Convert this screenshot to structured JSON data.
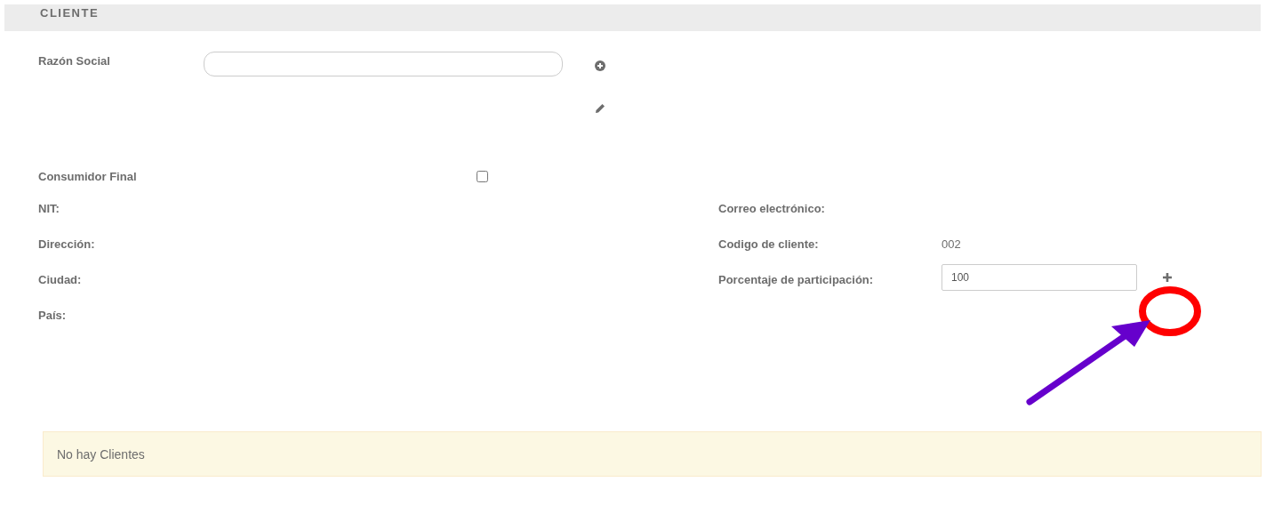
{
  "section": {
    "title": "CLIENTE"
  },
  "razon_social": {
    "label": "Razón Social"
  },
  "consumidor_final": {
    "label": "Consumidor Final",
    "checked": false
  },
  "left_fields": [
    {
      "label": "NIT:"
    },
    {
      "label": "Dirección:"
    },
    {
      "label": "Ciudad:"
    },
    {
      "label": "País:"
    }
  ],
  "right_fields": [
    {
      "label": "Correo electrónico:",
      "kind": "text"
    },
    {
      "label": "Codigo de cliente:",
      "kind": "text",
      "value": "002"
    },
    {
      "label": "Porcentaje de participación:",
      "kind": "input",
      "value": "100"
    }
  ],
  "alert": {
    "text": "No hay Clientes"
  },
  "annotations": [
    {
      "kind": "circle",
      "color": "#ff0000"
    },
    {
      "kind": "arrow",
      "color": "#6600cc"
    }
  ]
}
